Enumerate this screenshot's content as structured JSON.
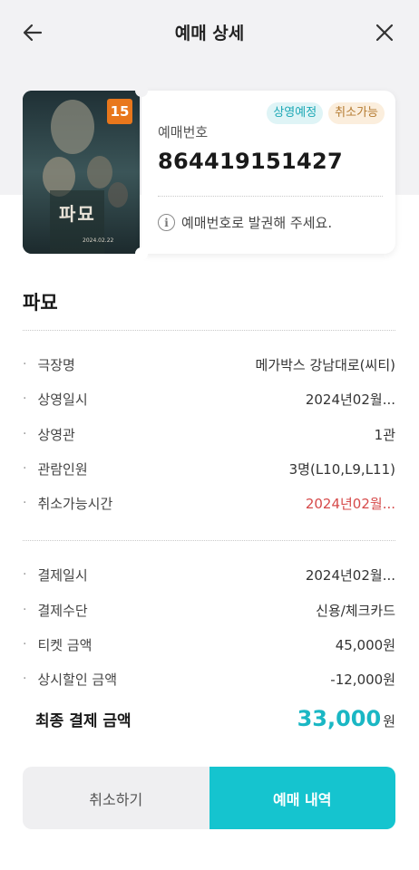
{
  "header": {
    "title": "예매 상세"
  },
  "ticket": {
    "rating": "15",
    "poster_title": "파묘",
    "poster_date": "2024.02.22",
    "badges": [
      "상영예정",
      "취소가능"
    ],
    "booking_label": "예매번호",
    "booking_number": "864419151427",
    "notice": "예매번호로 발권해 주세요."
  },
  "movie": {
    "title": "파묘"
  },
  "details": [
    {
      "label": "극장명",
      "value": "메가박스 강남대로(씨티)"
    },
    {
      "label": "상영일시",
      "value": "2024년02월..."
    },
    {
      "label": "상영관",
      "value": "1관"
    },
    {
      "label": "관람인원",
      "value": "3명(L10,L9,L11)"
    },
    {
      "label": "취소가능시간",
      "value": "2024년02월..."
    }
  ],
  "payment": [
    {
      "label": "결제일시",
      "value": "2024년02월..."
    },
    {
      "label": "결제수단",
      "value": "신용/체크카드"
    },
    {
      "label": "티켓 금액",
      "value": "45,000원"
    },
    {
      "label": "상시할인 금액",
      "value": "-12,000원"
    }
  ],
  "total": {
    "label": "최종 결제 금액",
    "amount": "33,000",
    "unit": "원"
  },
  "buttons": {
    "cancel": "취소하기",
    "history": "예매 내역"
  },
  "colors": {
    "accent": "#15c4cf",
    "warning": "#d64a4a",
    "rating": "#e8771c"
  }
}
